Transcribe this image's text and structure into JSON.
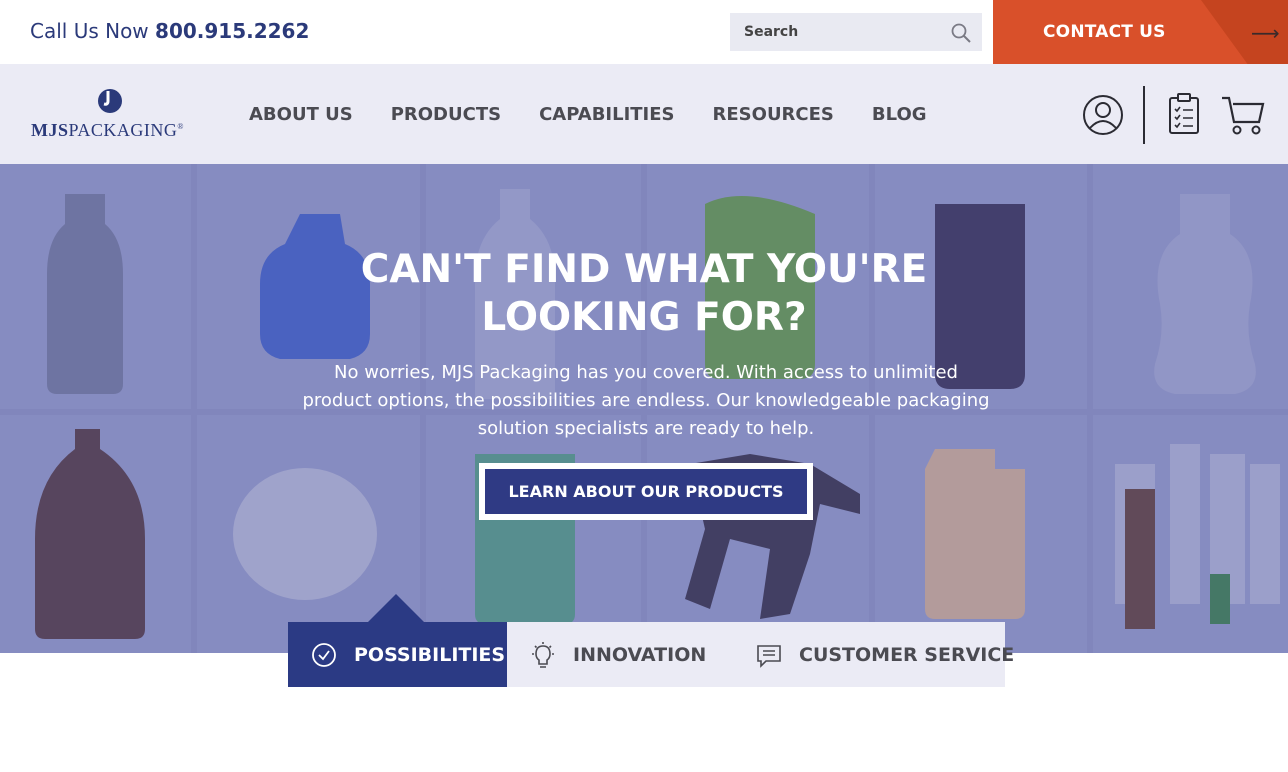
{
  "topbar": {
    "phone_prefix": "Call Us Now",
    "phone_number": "800.915.2262",
    "search_placeholder": "Search",
    "contact_label": "CONTACT US",
    "contact_arrow": "⟶"
  },
  "navbar": {
    "logo_text_bold": "MJS",
    "logo_text_rest": "PACKAGING",
    "logo_tm": "®",
    "items": [
      {
        "label": "ABOUT US"
      },
      {
        "label": "PRODUCTS"
      },
      {
        "label": "CAPABILITIES"
      },
      {
        "label": "RESOURCES"
      },
      {
        "label": "BLOG"
      }
    ],
    "icons": [
      "user-account-icon",
      "quote-clipboard-icon",
      "shopping-cart-icon"
    ]
  },
  "hero": {
    "heading": "CAN'T FIND WHAT YOU'RE LOOKING FOR?",
    "body": "No worries, MJS Packaging has you covered. With access to unlimited product options, the possibilities are endless. Our knowledgeable packaging solution specialists are ready to help.",
    "cta_label": "LEARN ABOUT OUR PRODUCTS"
  },
  "tabs": [
    {
      "label": "POSSIBILITIES",
      "icon": "check-circle-icon",
      "active": true
    },
    {
      "label": "INNOVATION",
      "icon": "lightbulb-icon",
      "active": false
    },
    {
      "label": "CUSTOMER SERVICE",
      "icon": "document-lines-icon",
      "active": false
    }
  ],
  "colors": {
    "brand_navy": "#2b3a84",
    "contact_orange": "#d9502a",
    "hero_tint": "#8a8fc0",
    "nav_bg": "#ebebf5"
  }
}
